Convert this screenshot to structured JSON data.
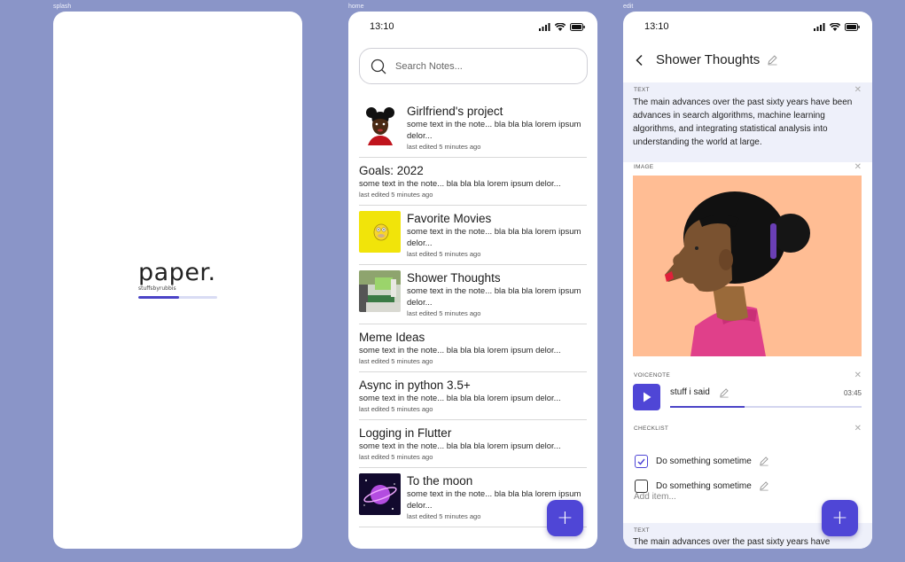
{
  "frames": {
    "splash_label": "splash",
    "home_label": "home",
    "edit_label": "edit"
  },
  "splash": {
    "logo": "paper.",
    "subtitle": "stuffsbyrubbis",
    "progress": 0.52
  },
  "status_bar": {
    "time": "13:10",
    "icons": [
      "signal-icon",
      "wifi-icon",
      "battery-icon"
    ]
  },
  "home": {
    "search": {
      "placeholder": "Search Notes..."
    },
    "notes": [
      {
        "title": "Girlfriend's project",
        "text": "some text in the note... bla bla bla lorem ipsum delor...",
        "meta": "last edited 5 minutes ago",
        "thumb": "portrait"
      },
      {
        "title": "Goals: 2022",
        "text": "some text in the note... bla bla bla lorem ipsum delor...",
        "meta": "last edited 5 minutes ago",
        "thumb": ""
      },
      {
        "title": "Favorite Movies",
        "text": "some text in the note... bla bla bla lorem ipsum delor...",
        "meta": "last edited 5 minutes ago",
        "thumb": "yellow"
      },
      {
        "title": "Shower Thoughts",
        "text": "some text in the note... bla bla bla lorem ipsum delor...",
        "meta": "last edited 5 minutes ago",
        "thumb": "room"
      },
      {
        "title": "Meme Ideas",
        "text": "some text in the note... bla bla bla lorem ipsum delor...",
        "meta": "last edited 5 minutes ago",
        "thumb": ""
      },
      {
        "title": "Async in python 3.5+",
        "text": "some text in the note... bla bla bla lorem ipsum delor...",
        "meta": "last edited 5 minutes ago",
        "thumb": ""
      },
      {
        "title": "Logging in Flutter",
        "text": "some text in the note... bla bla bla lorem ipsum delor...",
        "meta": "last edited 5 minutes ago",
        "thumb": ""
      },
      {
        "title": "To the moon",
        "text": "some text in the note... bla bla bla lorem ipsum delor...",
        "meta": "last edited 5 minutes ago",
        "thumb": "space"
      }
    ],
    "fab_label": "+"
  },
  "edit": {
    "title": "Shower Thoughts",
    "blocks": {
      "text1_label": "TEXT",
      "text1": "The main advances over the past sixty years have been advances in search algorithms, machine learning algorithms, and integrating statistical analysis into understanding the world at large.",
      "image_label": "IMAGE",
      "voice_label": "VOICENOTE",
      "voice_name": "stuff i said",
      "voice_time": "03:45",
      "voice_progress": 0.39,
      "checklist_label": "CHECKLIST",
      "checklist": [
        {
          "label": "Do something sometime",
          "checked": true
        },
        {
          "label": "Do something sometime",
          "checked": false
        }
      ],
      "add_item": "Add item...",
      "text2_label": "TEXT",
      "text2": "The main advances over the past sixty years have"
    },
    "close_glyph": "✕",
    "fab_label": "+"
  },
  "colors": {
    "background": "#8a95c8",
    "accent": "#4f46d6",
    "text_block_bg": "#eef0fa",
    "image_bg": "#ffbd94"
  }
}
